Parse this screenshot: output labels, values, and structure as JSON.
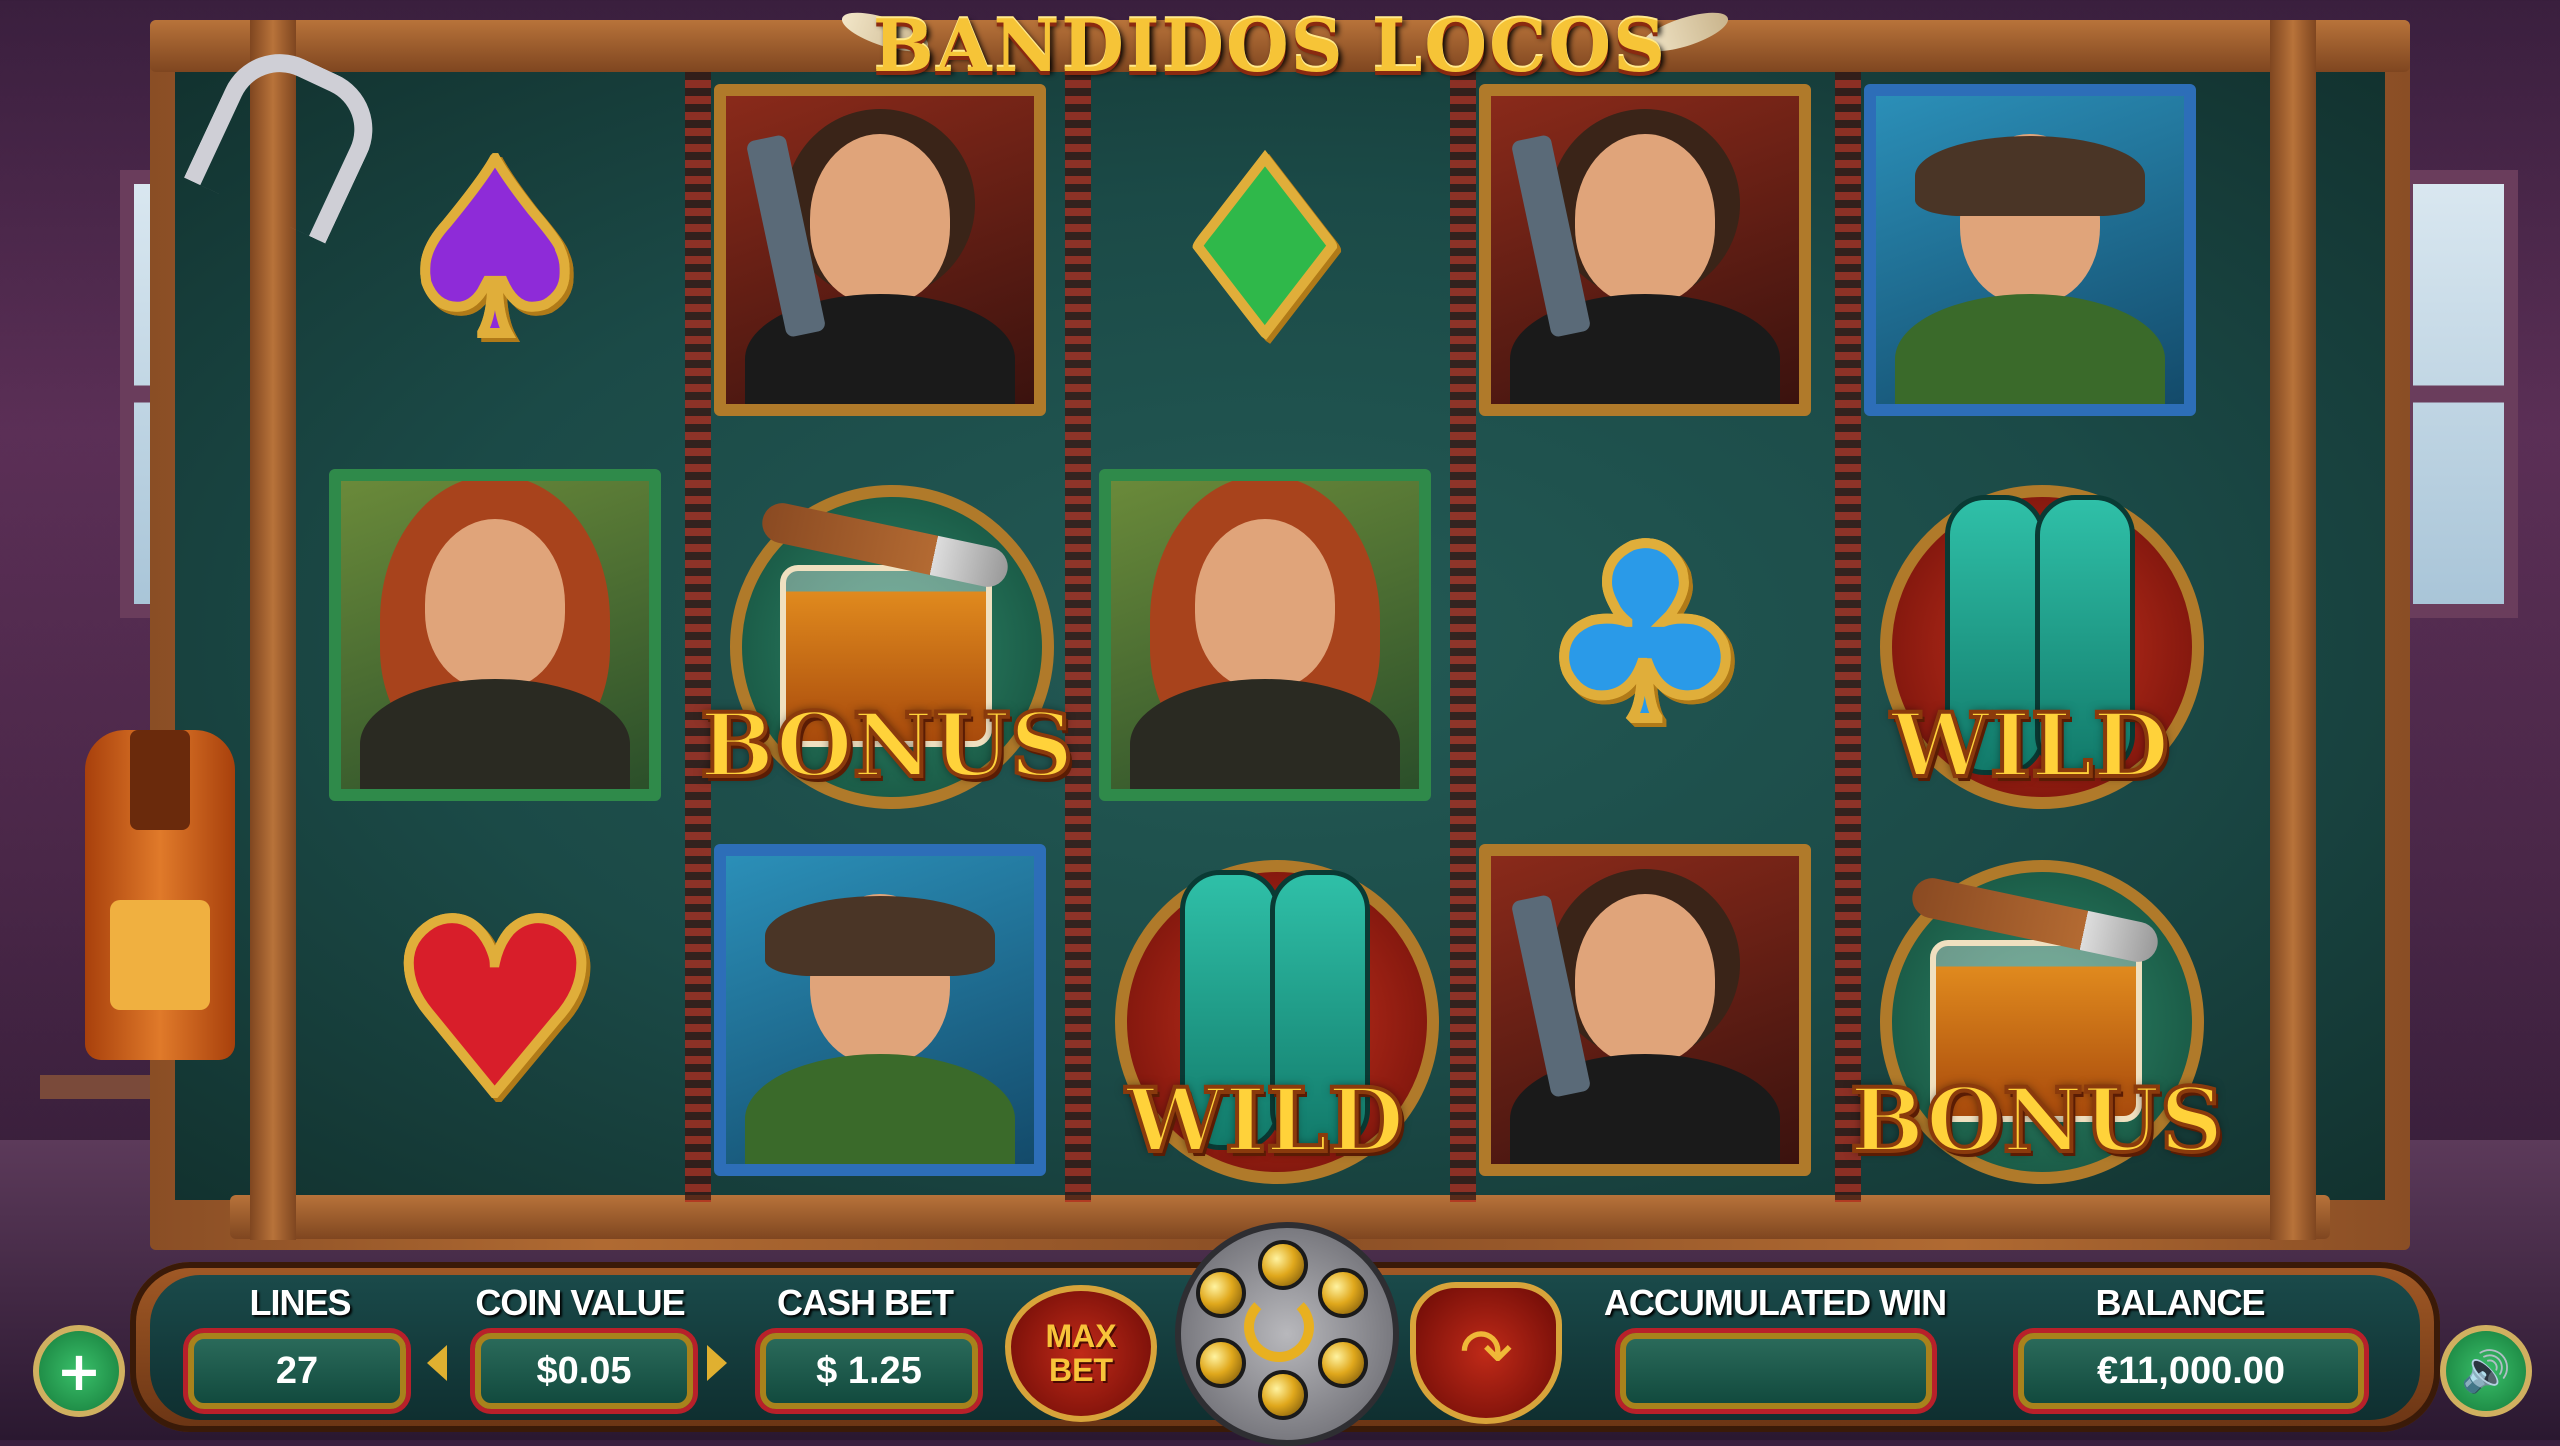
{
  "game": {
    "title": "BANDIDOS LOCOS"
  },
  "reels": {
    "rows": [
      [
        {
          "symbol": "spade",
          "type": "card"
        },
        {
          "symbol": "gunslinger",
          "type": "portrait"
        },
        {
          "symbol": "diamond",
          "type": "card"
        },
        {
          "symbol": "gunslinger",
          "type": "portrait"
        },
        {
          "symbol": "smoker",
          "type": "portrait"
        }
      ],
      [
        {
          "symbol": "lady",
          "type": "portrait"
        },
        {
          "symbol": "whiskey-cigar",
          "type": "bonus",
          "label": "BONUS"
        },
        {
          "symbol": "lady",
          "type": "portrait"
        },
        {
          "symbol": "club",
          "type": "card"
        },
        {
          "symbol": "guitar-cases",
          "type": "wild",
          "label": "WILD"
        }
      ],
      [
        {
          "symbol": "heart",
          "type": "card"
        },
        {
          "symbol": "smoker",
          "type": "portrait"
        },
        {
          "symbol": "guitar-cases",
          "type": "wild",
          "label": "WILD"
        },
        {
          "symbol": "gunslinger",
          "type": "portrait"
        },
        {
          "symbol": "whiskey-cigar",
          "type": "bonus",
          "label": "BONUS"
        }
      ]
    ]
  },
  "controls": {
    "lines_label": "LINES",
    "lines_value": "27",
    "coin_value_label": "COIN VALUE",
    "coin_value": "$0.05",
    "cash_bet_label": "CASH BET",
    "cash_bet_value": "$ 1.25",
    "max_bet_line1": "MAX",
    "max_bet_line2": "BET",
    "accumulated_win_label": "ACCUMULATED WIN",
    "accumulated_win_value": "",
    "balance_label": "BALANCE",
    "balance_value": "€11,000.00",
    "add_icon": "plus-icon",
    "sound_icon": "speaker-icon",
    "spin_icon": "spin-arrows-icon",
    "autoplay_icon": "autoplay-arrow-icon"
  },
  "colors": {
    "title_gold": "#f6c437",
    "panel_teal": "#1a4a4a",
    "accent_red": "#b8202a",
    "frame_wood": "#b06a32"
  }
}
